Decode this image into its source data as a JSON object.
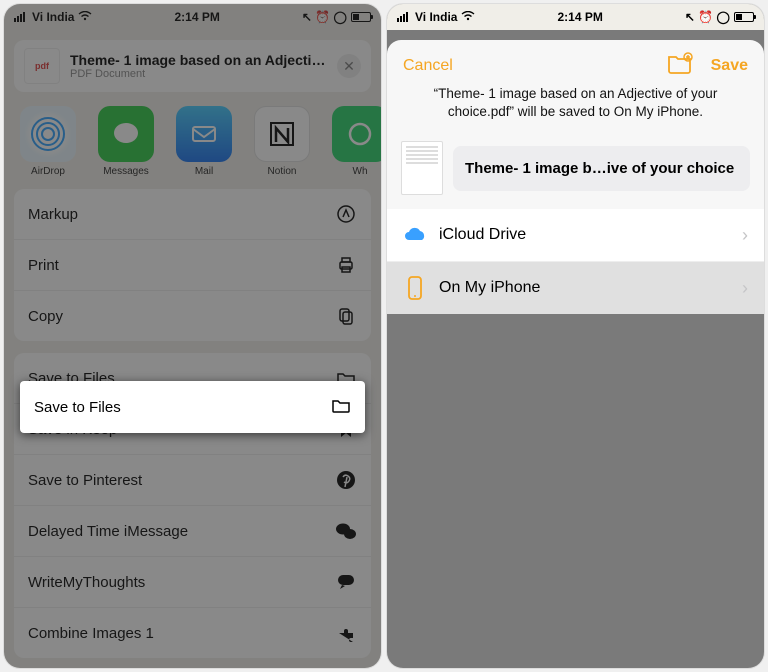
{
  "status": {
    "carrier": "Vi India",
    "time": "2:14 PM",
    "right_glyphs": "↖ ⏰ ◯"
  },
  "left": {
    "file_title": "Theme- 1 image based on an Adjective…",
    "file_type": "PDF Document",
    "apps": {
      "airdrop": "AirDrop",
      "messages": "Messages",
      "mail": "Mail",
      "notion": "Notion",
      "wa": "Wh"
    },
    "actions": {
      "markup": "Markup",
      "print": "Print",
      "copy": "Copy",
      "save_files": "Save to Files",
      "save_keep": "Save in Keep",
      "save_pinterest": "Save to Pinterest",
      "delayed_imsg": "Delayed Time iMessage",
      "writemythoughts": "WriteMyThoughts",
      "combine": "Combine Images 1"
    }
  },
  "right": {
    "cancel": "Cancel",
    "save": "Save",
    "desc": "“Theme- 1 image based on an Adjective of your choice.pdf” will be saved to On My iPhone.",
    "filename": "Theme- 1 image b…ive of your choice",
    "locations": {
      "icloud": "iCloud Drive",
      "onmy": "On My iPhone"
    }
  }
}
